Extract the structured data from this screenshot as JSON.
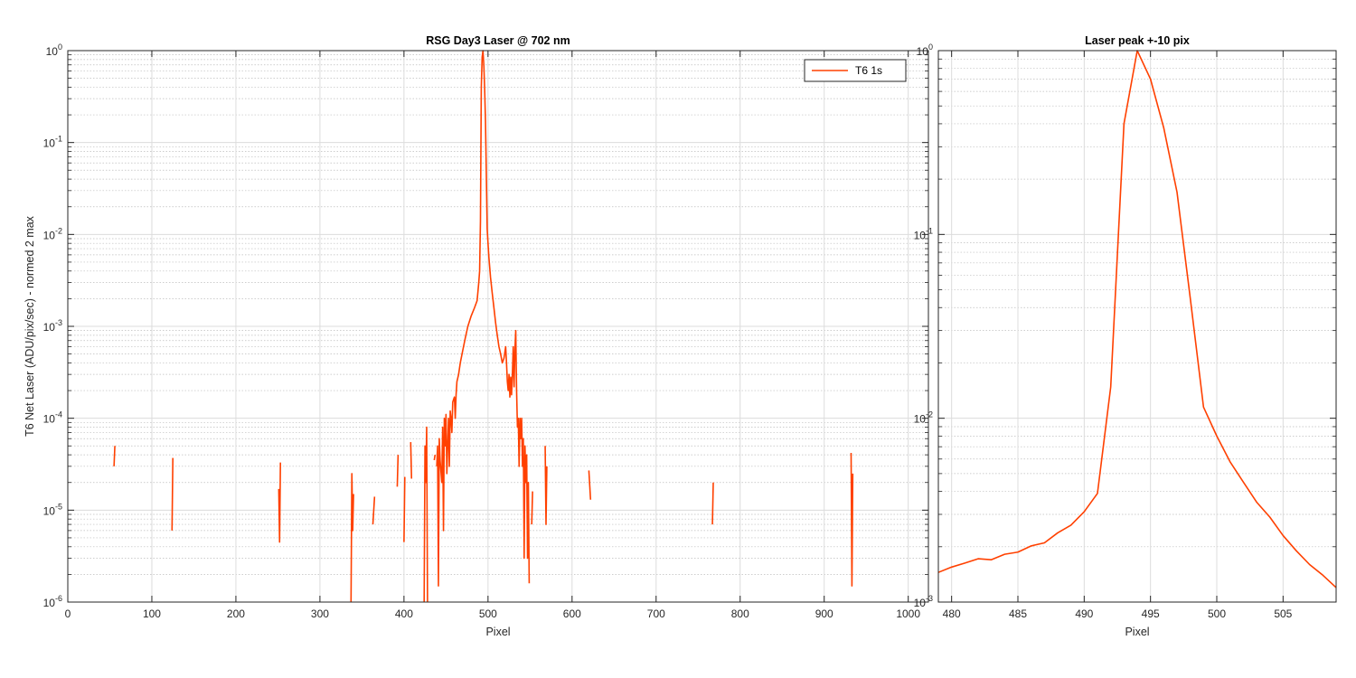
{
  "figure": {
    "background": "#ffffff",
    "line_color": "#ff4000",
    "grid_major_color": "#dcdcdc",
    "grid_minor_color": "#bdbdbd",
    "axis_color": "#262626"
  },
  "chart_data": [
    {
      "type": "line",
      "title": "RSG  Day3 Laser @ 702 nm",
      "xlabel": "Pixel",
      "ylabel": "T6 Net Laser (ADU/pix/sec) - normed 2 max",
      "xlim": [
        0,
        1024
      ],
      "ylim": [
        1e-06,
        1
      ],
      "yscale": "log",
      "grid": "on (major + minor)",
      "legend": {
        "placement": "top-right",
        "entries": [
          "T6 1s"
        ]
      },
      "xticks": [
        "0",
        "100",
        "200",
        "300",
        "400",
        "500",
        "600",
        "700",
        "800",
        "900",
        "1000"
      ],
      "yticks": [
        {
          "exp": "-6",
          "base": "10"
        },
        {
          "exp": "-5",
          "base": "10"
        },
        {
          "exp": "-4",
          "base": "10"
        },
        {
          "exp": "-3",
          "base": "10"
        },
        {
          "exp": "-2",
          "base": "10"
        },
        {
          "exp": "-1",
          "base": "10"
        },
        {
          "exp": "0",
          "base": "10"
        }
      ],
      "series": [
        {
          "name": "T6 1s",
          "segments": [
            [
              [
                55,
                3e-05
              ],
              [
                56,
                5e-05
              ]
            ],
            [
              [
                124,
                6e-06
              ],
              [
                125,
                3.7e-05
              ]
            ],
            [
              [
                251,
                1.7e-05
              ],
              [
                252,
                4.5e-06
              ],
              [
                253,
                3.3e-05
              ]
            ],
            [
              [
                337,
                1e-06
              ],
              [
                338,
                2.5e-05
              ],
              [
                339,
                6e-06
              ],
              [
                340,
                1.5e-05
              ]
            ],
            [
              [
                363,
                7e-06
              ],
              [
                365,
                1.4e-05
              ]
            ],
            [
              [
                392,
                1.8e-05
              ],
              [
                393,
                4e-05
              ]
            ],
            [
              [
                400,
                4.5e-06
              ],
              [
                401,
                2.3e-05
              ]
            ],
            [
              [
                408,
                5.5e-05
              ],
              [
                409,
                2.2e-05
              ]
            ],
            [
              [
                424,
                1e-06
              ],
              [
                425,
                5e-05
              ],
              [
                426,
                2e-05
              ],
              [
                427,
                8e-05
              ],
              [
                428,
                1e-06
              ]
            ],
            [
              [
                436,
                3.5e-05
              ],
              [
                437,
                4e-05
              ]
            ],
            [
              [
                439,
                3e-05
              ],
              [
                440,
                5e-05
              ],
              [
                441,
                1.5e-06
              ],
              [
                442,
                6e-05
              ],
              [
                443,
                3.5e-05
              ],
              [
                445,
                2e-05
              ],
              [
                446,
                8e-05
              ],
              [
                447,
                6e-06
              ],
              [
                448,
                0.0001
              ],
              [
                449,
                5e-05
              ],
              [
                450,
                0.00011
              ],
              [
                451,
                2.5e-05
              ],
              [
                452,
                5e-05
              ],
              [
                453,
                0.0001
              ],
              [
                454,
                3e-05
              ],
              [
                455,
                0.00012
              ],
              [
                456,
                0.0001
              ],
              [
                457,
                7e-05
              ],
              [
                458,
                0.00015
              ],
              [
                460,
                0.00017
              ],
              [
                461,
                0.0001
              ],
              [
                462,
                0.00018
              ],
              [
                463,
                0.00025
              ],
              [
                465,
                0.0003
              ],
              [
                467,
                0.0004
              ],
              [
                470,
                0.00055
              ],
              [
                473,
                0.00075
              ],
              [
                476,
                0.001
              ],
              [
                480,
                0.0013
              ],
              [
                484,
                0.0016
              ],
              [
                487,
                0.0019
              ],
              [
                489,
                0.003
              ],
              [
                490,
                0.004
              ],
              [
                491,
                0.014
              ],
              [
                492,
                0.4
              ],
              [
                493,
                0.85
              ],
              [
                494,
                1.0
              ],
              [
                495,
                0.7
              ],
              [
                496,
                0.38
              ],
              [
                497,
                0.17
              ],
              [
                498,
                0.045
              ],
              [
                499,
                0.0115
              ],
              [
                500,
                0.008
              ],
              [
                501,
                0.0057
              ],
              [
                502,
                0.0044
              ],
              [
                503,
                0.0034
              ],
              [
                504,
                0.0028
              ],
              [
                505,
                0.0023
              ],
              [
                507,
                0.0016
              ],
              [
                509,
                0.0011
              ],
              [
                511,
                0.0008
              ],
              [
                513,
                0.0006
              ],
              [
                515,
                0.0005
              ],
              [
                517,
                0.0004
              ],
              [
                519,
                0.00045
              ],
              [
                521,
                0.0006
              ],
              [
                522,
                0.0004
              ],
              [
                523,
                0.00025
              ],
              [
                524,
                0.0002
              ],
              [
                525,
                0.0003
              ],
              [
                526,
                0.00017
              ],
              [
                527,
                0.00028
              ],
              [
                528,
                0.00018
              ],
              [
                529,
                0.0003
              ],
              [
                530,
                0.0006
              ],
              [
                531,
                0.00022
              ],
              [
                532,
                0.00055
              ],
              [
                533,
                0.0009
              ],
              [
                534,
                0.0002
              ],
              [
                535,
                8e-05
              ],
              [
                536,
                0.0001
              ],
              [
                537,
                3e-05
              ],
              [
                538,
                0.0001
              ],
              [
                539,
                6e-05
              ],
              [
                540,
                0.0001
              ],
              [
                541,
                3e-05
              ],
              [
                542,
                6e-05
              ],
              [
                543,
                3e-06
              ],
              [
                544,
                5e-05
              ],
              [
                545,
                2e-05
              ],
              [
                546,
                4e-05
              ],
              [
                547,
                3e-06
              ],
              [
                548,
                2e-05
              ],
              [
                549,
                1.6e-06
              ]
            ],
            [
              [
                552,
                7e-06
              ],
              [
                553,
                1.6e-05
              ]
            ],
            [
              [
                568,
                5e-05
              ],
              [
                569,
                7e-06
              ],
              [
                570,
                3e-05
              ]
            ],
            [
              [
                620,
                2.7e-05
              ],
              [
                622,
                1.3e-05
              ]
            ],
            [
              [
                767,
                7e-06
              ],
              [
                768,
                2e-05
              ]
            ],
            [
              [
                932,
                4.2e-05
              ],
              [
                933,
                1.5e-06
              ],
              [
                934,
                2.5e-05
              ]
            ]
          ]
        }
      ]
    },
    {
      "type": "line",
      "title": "Laser peak +-10 pix",
      "xlabel": "Pixel",
      "ylabel": "",
      "xlim": [
        479,
        509
      ],
      "ylim": [
        0.001,
        1
      ],
      "yscale": "log",
      "grid": "on (major + minor)",
      "xticks": [
        "480",
        "485",
        "490",
        "495",
        "500",
        "505"
      ],
      "yticks": [
        {
          "exp": "-3",
          "base": "10"
        },
        {
          "exp": "-2",
          "base": "10"
        },
        {
          "exp": "-1",
          "base": "10"
        },
        {
          "exp": "0",
          "base": "10"
        }
      ],
      "series": [
        {
          "name": "T6 1s",
          "segments": [
            [
              [
                479,
                0.00145
              ],
              [
                480,
                0.00155
              ],
              [
                481,
                0.00163
              ],
              [
                482,
                0.00172
              ],
              [
                483,
                0.0017
              ],
              [
                484,
                0.00182
              ],
              [
                485,
                0.00187
              ],
              [
                486,
                0.00202
              ],
              [
                487,
                0.0021
              ],
              [
                488,
                0.00238
              ],
              [
                489,
                0.00262
              ],
              [
                490,
                0.0031
              ],
              [
                491,
                0.0039
              ],
              [
                492,
                0.0148
              ],
              [
                493,
                0.4
              ],
              [
                494,
                1.0
              ],
              [
                495,
                0.7
              ],
              [
                496,
                0.38
              ],
              [
                497,
                0.17
              ],
              [
                498,
                0.045
              ],
              [
                499,
                0.0115
              ],
              [
                500,
                0.008
              ],
              [
                501,
                0.0058
              ],
              [
                502,
                0.0045
              ],
              [
                503,
                0.0035
              ],
              [
                504,
                0.0029
              ],
              [
                505,
                0.0023
              ],
              [
                506,
                0.0019
              ],
              [
                507,
                0.0016
              ],
              [
                508,
                0.0014
              ],
              [
                509,
                0.0012
              ]
            ]
          ]
        }
      ]
    }
  ]
}
